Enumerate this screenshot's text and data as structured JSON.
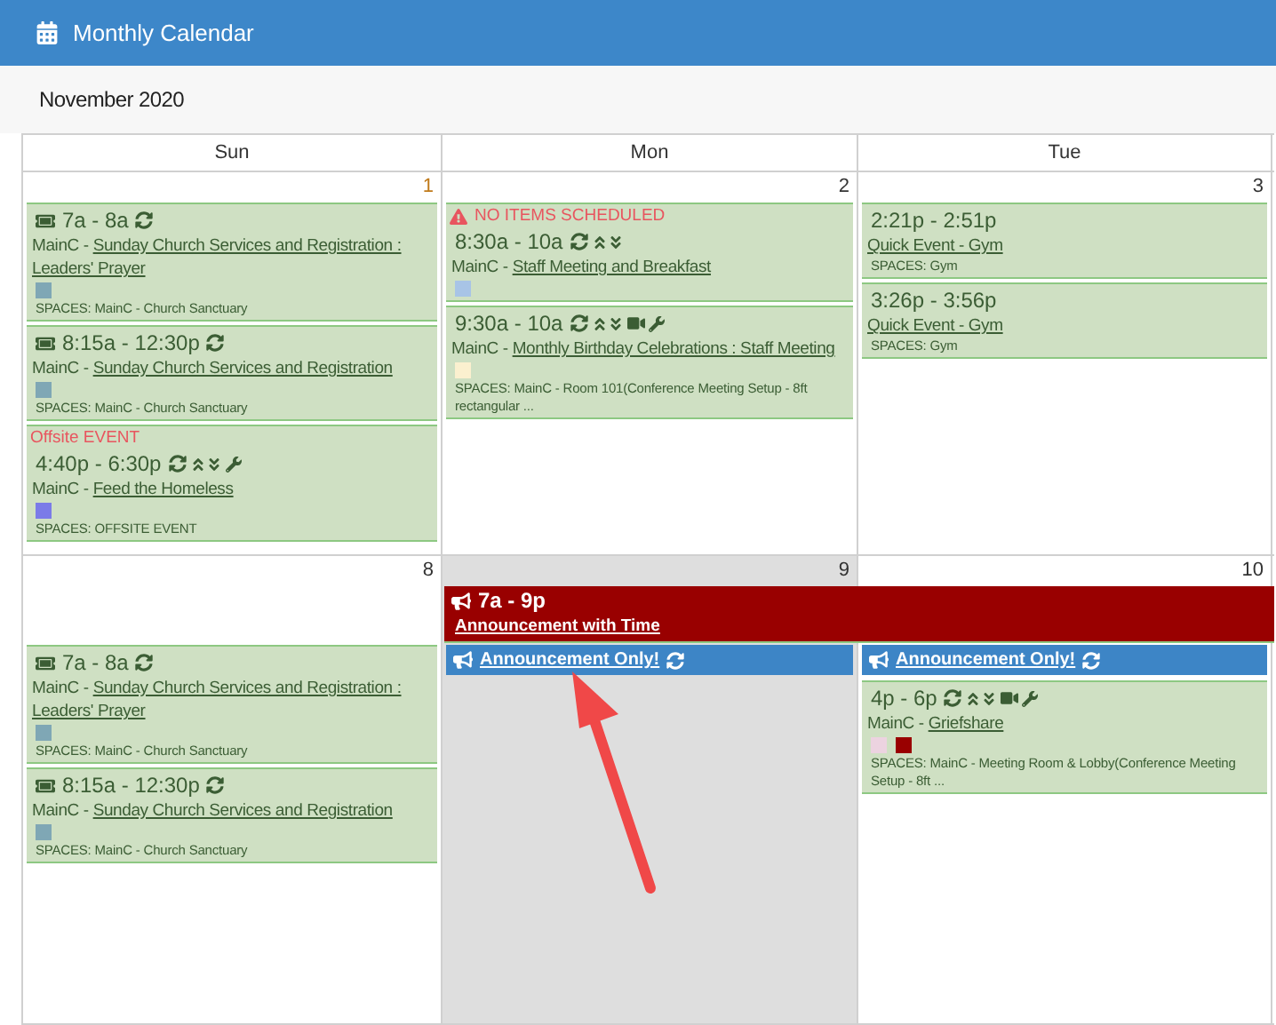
{
  "header": {
    "title": "Monthly Calendar"
  },
  "month": "November 2020",
  "weekdays": [
    "Sun",
    "Mon",
    "Tue"
  ],
  "weeks": [
    {
      "days": [
        {
          "date": "1",
          "today": false,
          "events": [
            {
              "kind": "event",
              "time": "7a - 8a",
              "ticketed": true,
              "recurring": true,
              "org": "MainC -",
              "title": "Sunday Church Services and Registration : Leaders' Prayer",
              "swatches": [
                {
                  "color": "#7fa7b5"
                }
              ],
              "spaces": "SPACES: MainC - Church Sanctuary"
            },
            {
              "kind": "event",
              "time": "8:15a - 12:30p",
              "ticketed": true,
              "recurring": true,
              "org": "MainC -",
              "title": "Sunday Church Services and Registration",
              "swatches": [
                {
                  "color": "#7fa7b5"
                }
              ],
              "spaces": "SPACES: MainC - Church Sanctuary"
            },
            {
              "kind": "event",
              "notice": "Offsite EVENT",
              "time": "4:40p - 6:30p",
              "recurring": true,
              "priority": true,
              "setup": true,
              "org": "MainC -",
              "title": "Feed the Homeless",
              "swatches": [
                {
                  "color": "#7b7be8"
                }
              ],
              "spaces": "SPACES: OFFSITE EVENT"
            }
          ]
        },
        {
          "date": "2",
          "today": false,
          "events": [
            {
              "kind": "event",
              "notice": "NO ITEMS SCHEDULED",
              "warning": true,
              "time": "8:30a - 10a",
              "recurring": true,
              "priority": true,
              "org": "MainC -",
              "title": "Staff Meeting and Breakfast",
              "swatches": [
                {
                  "color": "#a8c4e6"
                }
              ]
            },
            {
              "kind": "event",
              "time": "9:30a - 10a",
              "recurring": true,
              "priority": true,
              "video": true,
              "setup": true,
              "org": "MainC -",
              "title": "Monthly Birthday Celebrations : Staff Meeting",
              "swatches": [
                {
                  "color": "#fbf0cf"
                }
              ],
              "spaces": "SPACES: MainC - Room 101(Conference Meeting Setup - 8ft rectangular ..."
            }
          ]
        },
        {
          "date": "3",
          "today": false,
          "events": [
            {
              "kind": "quick",
              "time": "2:21p - 2:51p",
              "title": "Quick Event - Gym",
              "spaces": "SPACES: Gym"
            },
            {
              "kind": "quick",
              "time": "3:26p - 3:56p",
              "title": "Quick Event - Gym",
              "spaces": "SPACES: Gym"
            }
          ]
        }
      ]
    },
    {
      "banners": [
        {
          "time": "7a - 9p",
          "title": "Announcement with Time"
        }
      ],
      "days": [
        {
          "date": "8",
          "today": false,
          "events": [
            {
              "kind": "event",
              "time": "7a - 8a",
              "ticketed": true,
              "recurring": true,
              "org": "MainC -",
              "title": "Sunday Church Services and Registration : Leaders' Prayer",
              "swatches": [
                {
                  "color": "#7fa7b5"
                }
              ],
              "spaces": "SPACES: MainC - Church Sanctuary"
            },
            {
              "kind": "event",
              "time": "8:15a - 12:30p",
              "ticketed": true,
              "recurring": true,
              "org": "MainC -",
              "title": "Sunday Church Services and Registration",
              "swatches": [
                {
                  "color": "#7fa7b5"
                }
              ],
              "spaces": "SPACES: MainC - Church Sanctuary"
            }
          ]
        },
        {
          "date": "9",
          "today": true,
          "events": [
            {
              "kind": "announcement",
              "title": "Announcement Only!",
              "recurring": true
            }
          ]
        },
        {
          "date": "10",
          "today": false,
          "events": [
            {
              "kind": "announcement",
              "title": "Announcement Only!",
              "recurring": true
            },
            {
              "kind": "event",
              "time": "4p - 6p",
              "recurring": true,
              "priority": true,
              "video": true,
              "setup": true,
              "org": "MainC -",
              "title": "Griefshare",
              "swatches": [
                {
                  "color": "#ecd3e0"
                },
                {
                  "color": "#990000"
                }
              ],
              "spaces": "SPACES: MainC - Meeting Room & Lobby(Conference Meeting Setup - 8ft ..."
            }
          ]
        }
      ]
    }
  ]
}
